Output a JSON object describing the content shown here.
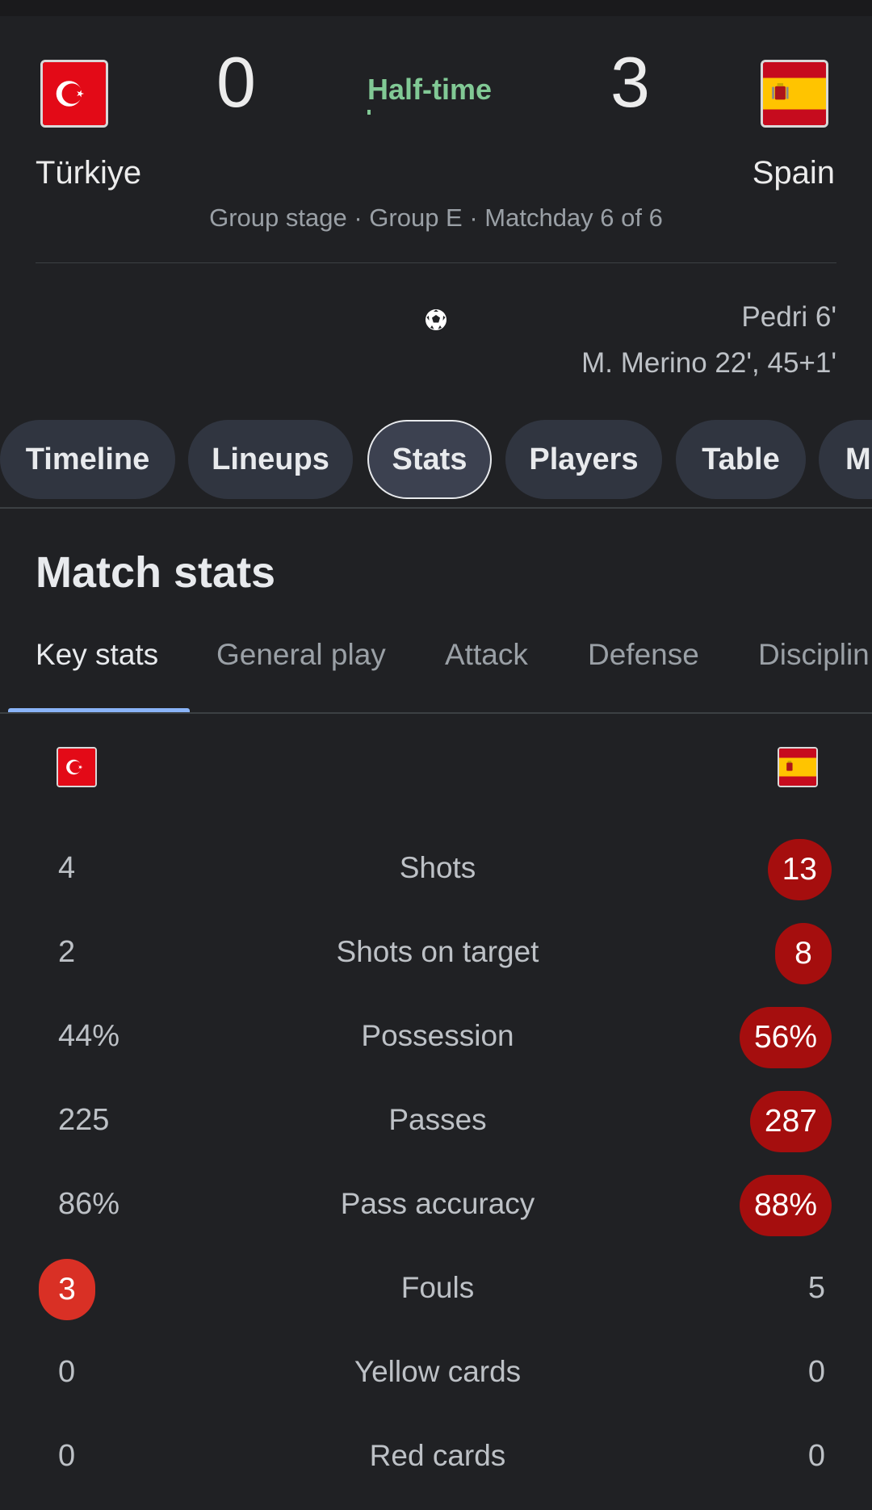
{
  "match": {
    "home": {
      "name": "Türkiye",
      "score": "0",
      "flag_icon": "turkey-flag-icon"
    },
    "away": {
      "name": "Spain",
      "score": "3",
      "flag_icon": "spain-flag-icon"
    },
    "status": "Half-time",
    "competition": "Group stage · Group E · Matchday 6 of 6",
    "goals_away": [
      "Pedri 6'",
      "M. Merino 22', 45+1'"
    ],
    "goal_icon": "soccer-ball-icon"
  },
  "tabs": [
    {
      "label": "Timeline"
    },
    {
      "label": "Lineups"
    },
    {
      "label": "Stats"
    },
    {
      "label": "Players"
    },
    {
      "label": "Table"
    },
    {
      "label": "M"
    }
  ],
  "active_tab": "Stats",
  "stats": {
    "title": "Match stats",
    "subtabs": [
      "Key stats",
      "General play",
      "Attack",
      "Defense",
      "Disciplin"
    ],
    "active_subtab": "Key stats",
    "rows": [
      {
        "label": "Shots",
        "home": "4",
        "away": "13",
        "leader": "away"
      },
      {
        "label": "Shots on target",
        "home": "2",
        "away": "8",
        "leader": "away"
      },
      {
        "label": "Possession",
        "home": "44%",
        "away": "56%",
        "leader": "away"
      },
      {
        "label": "Passes",
        "home": "225",
        "away": "287",
        "leader": "away"
      },
      {
        "label": "Pass accuracy",
        "home": "86%",
        "away": "88%",
        "leader": "away"
      },
      {
        "label": "Fouls",
        "home": "3",
        "away": "5",
        "leader": "home"
      },
      {
        "label": "Yellow cards",
        "home": "0",
        "away": "0",
        "leader": "none"
      },
      {
        "label": "Red cards",
        "home": "0",
        "away": "0",
        "leader": "none"
      }
    ]
  },
  "colors": {
    "background": "#202124",
    "status_green": "#81c995",
    "leader_away": "#a50e0e",
    "leader_home": "#d93025",
    "tab_indicator": "#8ab4f8"
  }
}
